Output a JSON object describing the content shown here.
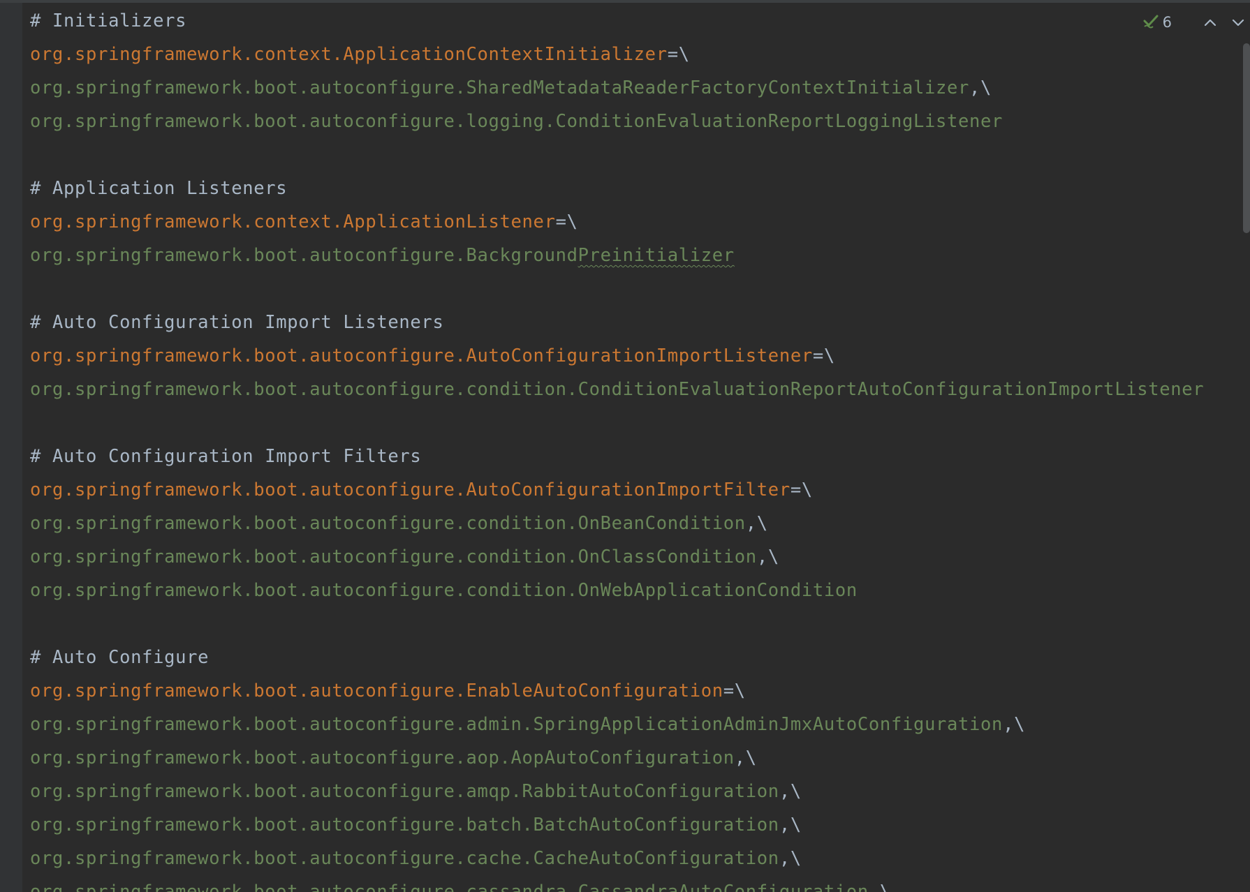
{
  "editor": {
    "inspection": {
      "count": "6",
      "icon": "check-icon",
      "prev_icon": "chevron-up-icon",
      "next_icon": "chevron-down-icon"
    },
    "colors": {
      "background": "#2b2b2b",
      "gutter": "#313335",
      "comment": "#a9b7c6",
      "key": "#cc7832",
      "value": "#6a8759",
      "squiggle": "#6a8759"
    },
    "lines": [
      {
        "kind": "comment",
        "text": "# Initializers"
      },
      {
        "kind": "key",
        "text": "org.springframework.context.ApplicationContextInitializer",
        "suffix": "=\\"
      },
      {
        "kind": "value",
        "text": "org.springframework.boot.autoconfigure.SharedMetadataReaderFactoryContextInitializer",
        "suffix": ",\\"
      },
      {
        "kind": "value",
        "text": "org.springframework.boot.autoconfigure.logging.ConditionEvaluationReportLoggingListener",
        "suffix": ""
      },
      {
        "kind": "blank",
        "text": ""
      },
      {
        "kind": "comment",
        "text": "# Application Listeners"
      },
      {
        "kind": "key",
        "text": "org.springframework.context.ApplicationListener",
        "suffix": "=\\"
      },
      {
        "kind": "value",
        "text": "org.springframework.boot.autoconfigure.Background",
        "squiggle": "Preinitializer",
        "suffix": ""
      },
      {
        "kind": "blank",
        "text": ""
      },
      {
        "kind": "comment",
        "text": "# Auto Configuration Import Listeners"
      },
      {
        "kind": "key",
        "text": "org.springframework.boot.autoconfigure.AutoConfigurationImportListener",
        "suffix": "=\\"
      },
      {
        "kind": "value",
        "text": "org.springframework.boot.autoconfigure.condition.ConditionEvaluationReportAutoConfigurationImportListener",
        "suffix": ""
      },
      {
        "kind": "blank",
        "text": ""
      },
      {
        "kind": "comment",
        "text": "# Auto Configuration Import Filters"
      },
      {
        "kind": "key",
        "text": "org.springframework.boot.autoconfigure.AutoConfigurationImportFilter",
        "suffix": "=\\"
      },
      {
        "kind": "value",
        "text": "org.springframework.boot.autoconfigure.condition.OnBeanCondition",
        "suffix": ",\\"
      },
      {
        "kind": "value",
        "text": "org.springframework.boot.autoconfigure.condition.OnClassCondition",
        "suffix": ",\\"
      },
      {
        "kind": "value",
        "text": "org.springframework.boot.autoconfigure.condition.OnWebApplicationCondition",
        "suffix": ""
      },
      {
        "kind": "blank",
        "text": ""
      },
      {
        "kind": "comment",
        "text": "# Auto Configure"
      },
      {
        "kind": "key",
        "text": "org.springframework.boot.autoconfigure.EnableAutoConfiguration",
        "suffix": "=\\"
      },
      {
        "kind": "value",
        "text": "org.springframework.boot.autoconfigure.admin.SpringApplicationAdminJmxAutoConfiguration",
        "suffix": ",\\"
      },
      {
        "kind": "value",
        "text": "org.springframework.boot.autoconfigure.aop.AopAutoConfiguration",
        "suffix": ",\\"
      },
      {
        "kind": "value",
        "text": "org.springframework.boot.autoconfigure.amqp.RabbitAutoConfiguration",
        "suffix": ",\\"
      },
      {
        "kind": "value",
        "text": "org.springframework.boot.autoconfigure.batch.BatchAutoConfiguration",
        "suffix": ",\\"
      },
      {
        "kind": "value",
        "text": "org.springframework.boot.autoconfigure.cache.CacheAutoConfiguration",
        "suffix": ",\\"
      },
      {
        "kind": "value",
        "text": "org.springframework.boot.autoconfigure.cassandra.CassandraAutoConfiguration",
        "suffix": ",\\"
      }
    ]
  }
}
